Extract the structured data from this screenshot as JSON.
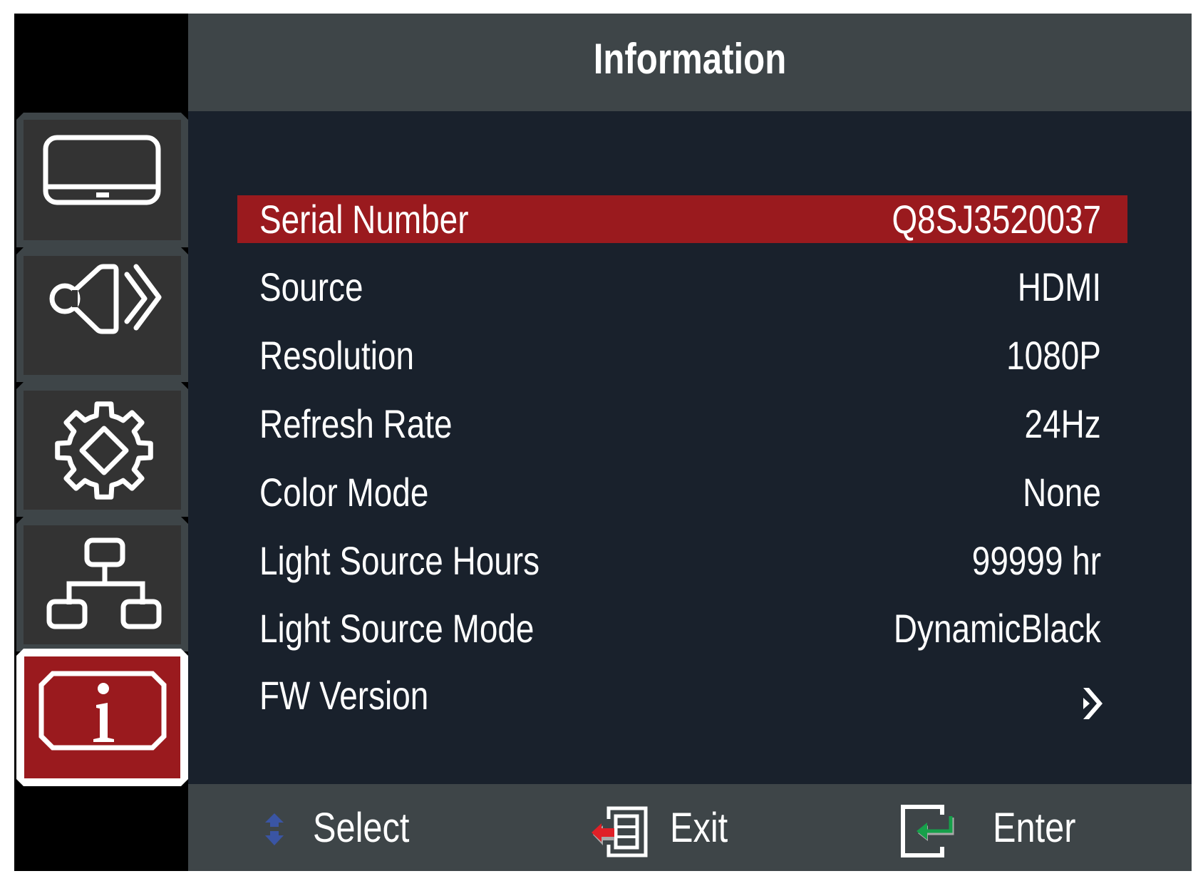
{
  "header": {
    "title": "Information"
  },
  "sidebar": {
    "items": [
      {
        "name": "display",
        "icon": "monitor-icon",
        "selected": false
      },
      {
        "name": "audio",
        "icon": "speaker-icon",
        "selected": false
      },
      {
        "name": "settings",
        "icon": "gear-icon",
        "selected": false
      },
      {
        "name": "network",
        "icon": "network-icon",
        "selected": false
      },
      {
        "name": "information",
        "icon": "info-icon",
        "selected": true
      }
    ]
  },
  "info": {
    "rows": [
      {
        "label": "Serial Number",
        "value": "Q8SJ3520037",
        "selected": true
      },
      {
        "label": "Source",
        "value": "HDMI"
      },
      {
        "label": "Resolution",
        "value": "1080P"
      },
      {
        "label": "Refresh Rate",
        "value": "24Hz"
      },
      {
        "label": "Color Mode",
        "value": "None"
      },
      {
        "label": "Light Source Hours",
        "value": "99999 hr"
      },
      {
        "label": "Light Source Mode",
        "value": "DynamicBlack"
      },
      {
        "label": "FW Version",
        "value": "",
        "submenu_icon": "chevron-right-icon"
      }
    ]
  },
  "footer": {
    "select_label": "Select",
    "exit_label": "Exit",
    "enter_label": "Enter"
  },
  "colors": {
    "highlight": "#9a1a1e",
    "header_bg": "#3e4548",
    "body_bg": "#19212c",
    "tile_bg": "#333333",
    "select_arrow": "#3a55a4",
    "exit_arrow": "#e02027",
    "enter_arrow": "#16a04a"
  }
}
